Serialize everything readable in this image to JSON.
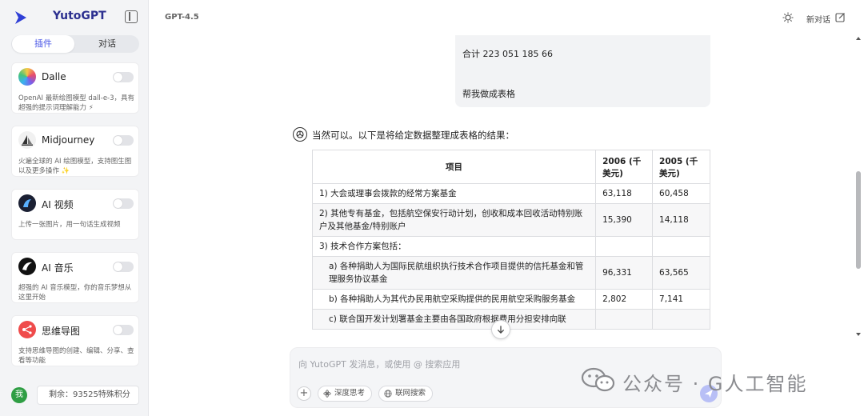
{
  "app": {
    "name": "YutoGPT",
    "model": "GPT-4.5"
  },
  "sidebar": {
    "tabs": [
      {
        "label": "插件",
        "active": true
      },
      {
        "label": "对话",
        "active": false
      }
    ],
    "plugins": [
      {
        "name": "Dalle",
        "desc": "OpenAI 最新绘图模型 dall-e-3，具有超强的提示词理解能力 ⚡",
        "enabled": false
      },
      {
        "name": "Midjourney",
        "desc": "火遍全球的 AI 绘图模型，支持图生图以及更多操作 ✨",
        "enabled": false
      },
      {
        "name": "AI 视频",
        "desc": "上传一张图片，用一句话生成视频",
        "enabled": false
      },
      {
        "name": "AI 音乐",
        "desc": "超强的 AI 音乐模型，你的音乐梦想从这里开始",
        "enabled": false
      },
      {
        "name": "思维导图",
        "desc": "支持思维导图的创建、编辑、分享、查看等功能",
        "enabled": false
      }
    ],
    "user_initial": "我",
    "credits": "剩余：93525特殊积分"
  },
  "header": {
    "new_chat": "新对话"
  },
  "messages": {
    "user_lines": [
      "合计 223 051   185 66",
      "帮我做成表格"
    ],
    "assistant_intro": "当然可以。以下是将给定数据整理成表格的结果：",
    "table": {
      "headers": [
        "项目",
        "2006 (千美元)",
        "2005 (千美元)"
      ],
      "rows": [
        [
          "1) 大会或理事会拨款的经常方案基金",
          "63,118",
          "60,458"
        ],
        [
          "2) 其他专有基金，包括航空保安行动计划，创收和成本回收活动特别账户及其他基金/特别账户",
          "15,390",
          "14,118"
        ],
        [
          "3) 技术合作方案包括：",
          "",
          ""
        ],
        [
          "a) 各种捐助人为国际民航组织执行技术合作项目提供的信托基金和管理服务协议基金",
          "96,331",
          "63,565"
        ],
        [
          "b) 各种捐助人为其代办民用航空采购提供的民用航空采购服务基金",
          "2,802",
          "7,141"
        ],
        [
          "c) 联合国开发计划署基金主要由各国政府根据费用分担安排向联",
          "",
          ""
        ]
      ]
    }
  },
  "composer": {
    "placeholder": "向 YutoGPT 发消息，或使用 @ 搜索应用",
    "chips": [
      "深度思考",
      "联网搜索"
    ]
  },
  "watermark": {
    "text": "公众号 · G人工智能"
  },
  "colors": {
    "accent": "#4a57e6",
    "user_bubble": "#f2f3f5",
    "send": "#b8bff6"
  }
}
